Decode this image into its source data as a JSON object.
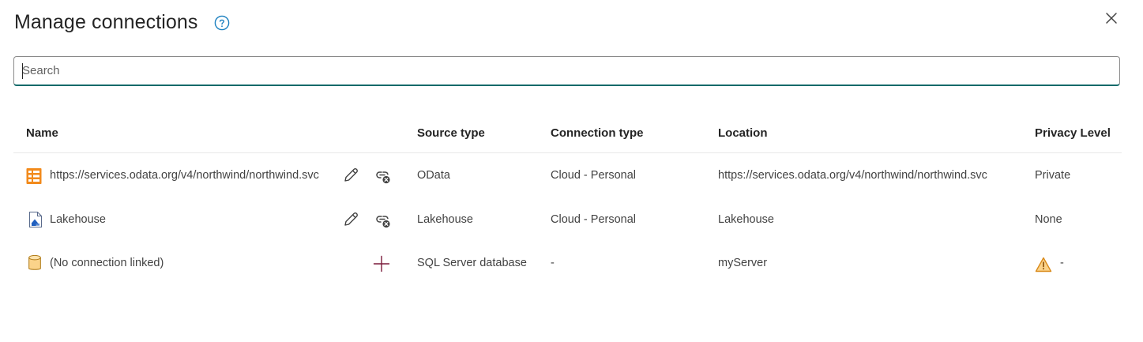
{
  "dialog": {
    "title": "Manage connections"
  },
  "search": {
    "placeholder": "Search"
  },
  "columns": {
    "name": "Name",
    "source_type": "Source type",
    "connection_type": "Connection type",
    "location": "Location",
    "privacy_level": "Privacy Level"
  },
  "rows": [
    {
      "icon": "odata-icon",
      "name": "https://services.odata.org/v4/northwind/northwind.svc",
      "source_type": "OData",
      "connection_type": "Cloud - Personal",
      "location": "https://services.odata.org/v4/northwind/northwind.svc",
      "privacy_level": "Private",
      "actions": [
        "edit-icon",
        "unlink-icon"
      ]
    },
    {
      "icon": "lakehouse-icon",
      "name": "Lakehouse",
      "source_type": "Lakehouse",
      "connection_type": "Cloud - Personal",
      "location": "Lakehouse",
      "privacy_level": "None",
      "actions": [
        "edit-icon",
        "unlink-icon"
      ]
    },
    {
      "icon": "database-icon",
      "name": "(No connection linked)",
      "source_type": "SQL Server database",
      "connection_type": "-",
      "location": "myServer",
      "privacy_level": "-",
      "privacy_icon": "warning-icon",
      "actions": [
        "add-icon"
      ]
    }
  ],
  "colors": {
    "accent": "#0f6a6a",
    "help": "#1a7fbf",
    "odata": "#f28a1b",
    "warning": "#d98a1a",
    "add": "#7a1a3a"
  }
}
